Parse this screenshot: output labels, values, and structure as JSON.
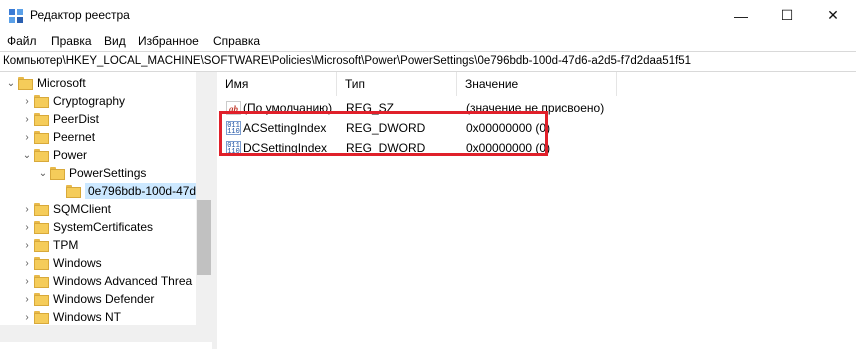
{
  "window": {
    "title": "Редактор реестра",
    "minimize": "—",
    "maximize": "☐",
    "close": "✕"
  },
  "menu": [
    "Файл",
    "Правка",
    "Вид",
    "Избранное",
    "Справка"
  ],
  "address": "Компьютер\\HKEY_LOCAL_MACHINE\\SOFTWARE\\Policies\\Microsoft\\Power\\PowerSettings\\0e796bdb-100d-47d6-a2d5-f7d2daa51f51",
  "tree": [
    {
      "label": "Microsoft",
      "chev": "⌄",
      "level": 0,
      "selected": false
    },
    {
      "label": "Cryptography",
      "chev": "›",
      "level": 1,
      "selected": false
    },
    {
      "label": "PeerDist",
      "chev": "›",
      "level": 1,
      "selected": false
    },
    {
      "label": "Peernet",
      "chev": "›",
      "level": 1,
      "selected": false
    },
    {
      "label": "Power",
      "chev": "⌄",
      "level": 1,
      "selected": false
    },
    {
      "label": "PowerSettings",
      "chev": "⌄",
      "level": 2,
      "selected": false
    },
    {
      "label": "0e796bdb-100d-47d",
      "chev": "",
      "level": 3,
      "selected": true
    },
    {
      "label": "SQMClient",
      "chev": "›",
      "level": 1,
      "selected": false
    },
    {
      "label": "SystemCertificates",
      "chev": "›",
      "level": 1,
      "selected": false
    },
    {
      "label": "TPM",
      "chev": "›",
      "level": 1,
      "selected": false
    },
    {
      "label": "Windows",
      "chev": "›",
      "level": 1,
      "selected": false
    },
    {
      "label": "Windows Advanced Threa",
      "chev": "›",
      "level": 1,
      "selected": false
    },
    {
      "label": "Windows Defender",
      "chev": "›",
      "level": 1,
      "selected": false
    },
    {
      "label": "Windows NT",
      "chev": "›",
      "level": 1,
      "selected": false
    }
  ],
  "columns": {
    "name": "Имя",
    "type": "Тип",
    "value": "Значение"
  },
  "values": [
    {
      "icon": "ab-icon",
      "name": "(По умолчанию)",
      "type": "REG_SZ",
      "data": "(значение не присвоено)"
    },
    {
      "icon": "binary-icon",
      "name": "ACSettingIndex",
      "type": "REG_DWORD",
      "data": "0x00000000 (0)"
    },
    {
      "icon": "binary-icon",
      "name": "DCSettingIndex",
      "type": "REG_DWORD",
      "data": "0x00000000 (0)"
    }
  ],
  "colors": {
    "selection": "#cce8ff",
    "highlight_box": "#e0202a",
    "folder": "#f5cc5a"
  }
}
